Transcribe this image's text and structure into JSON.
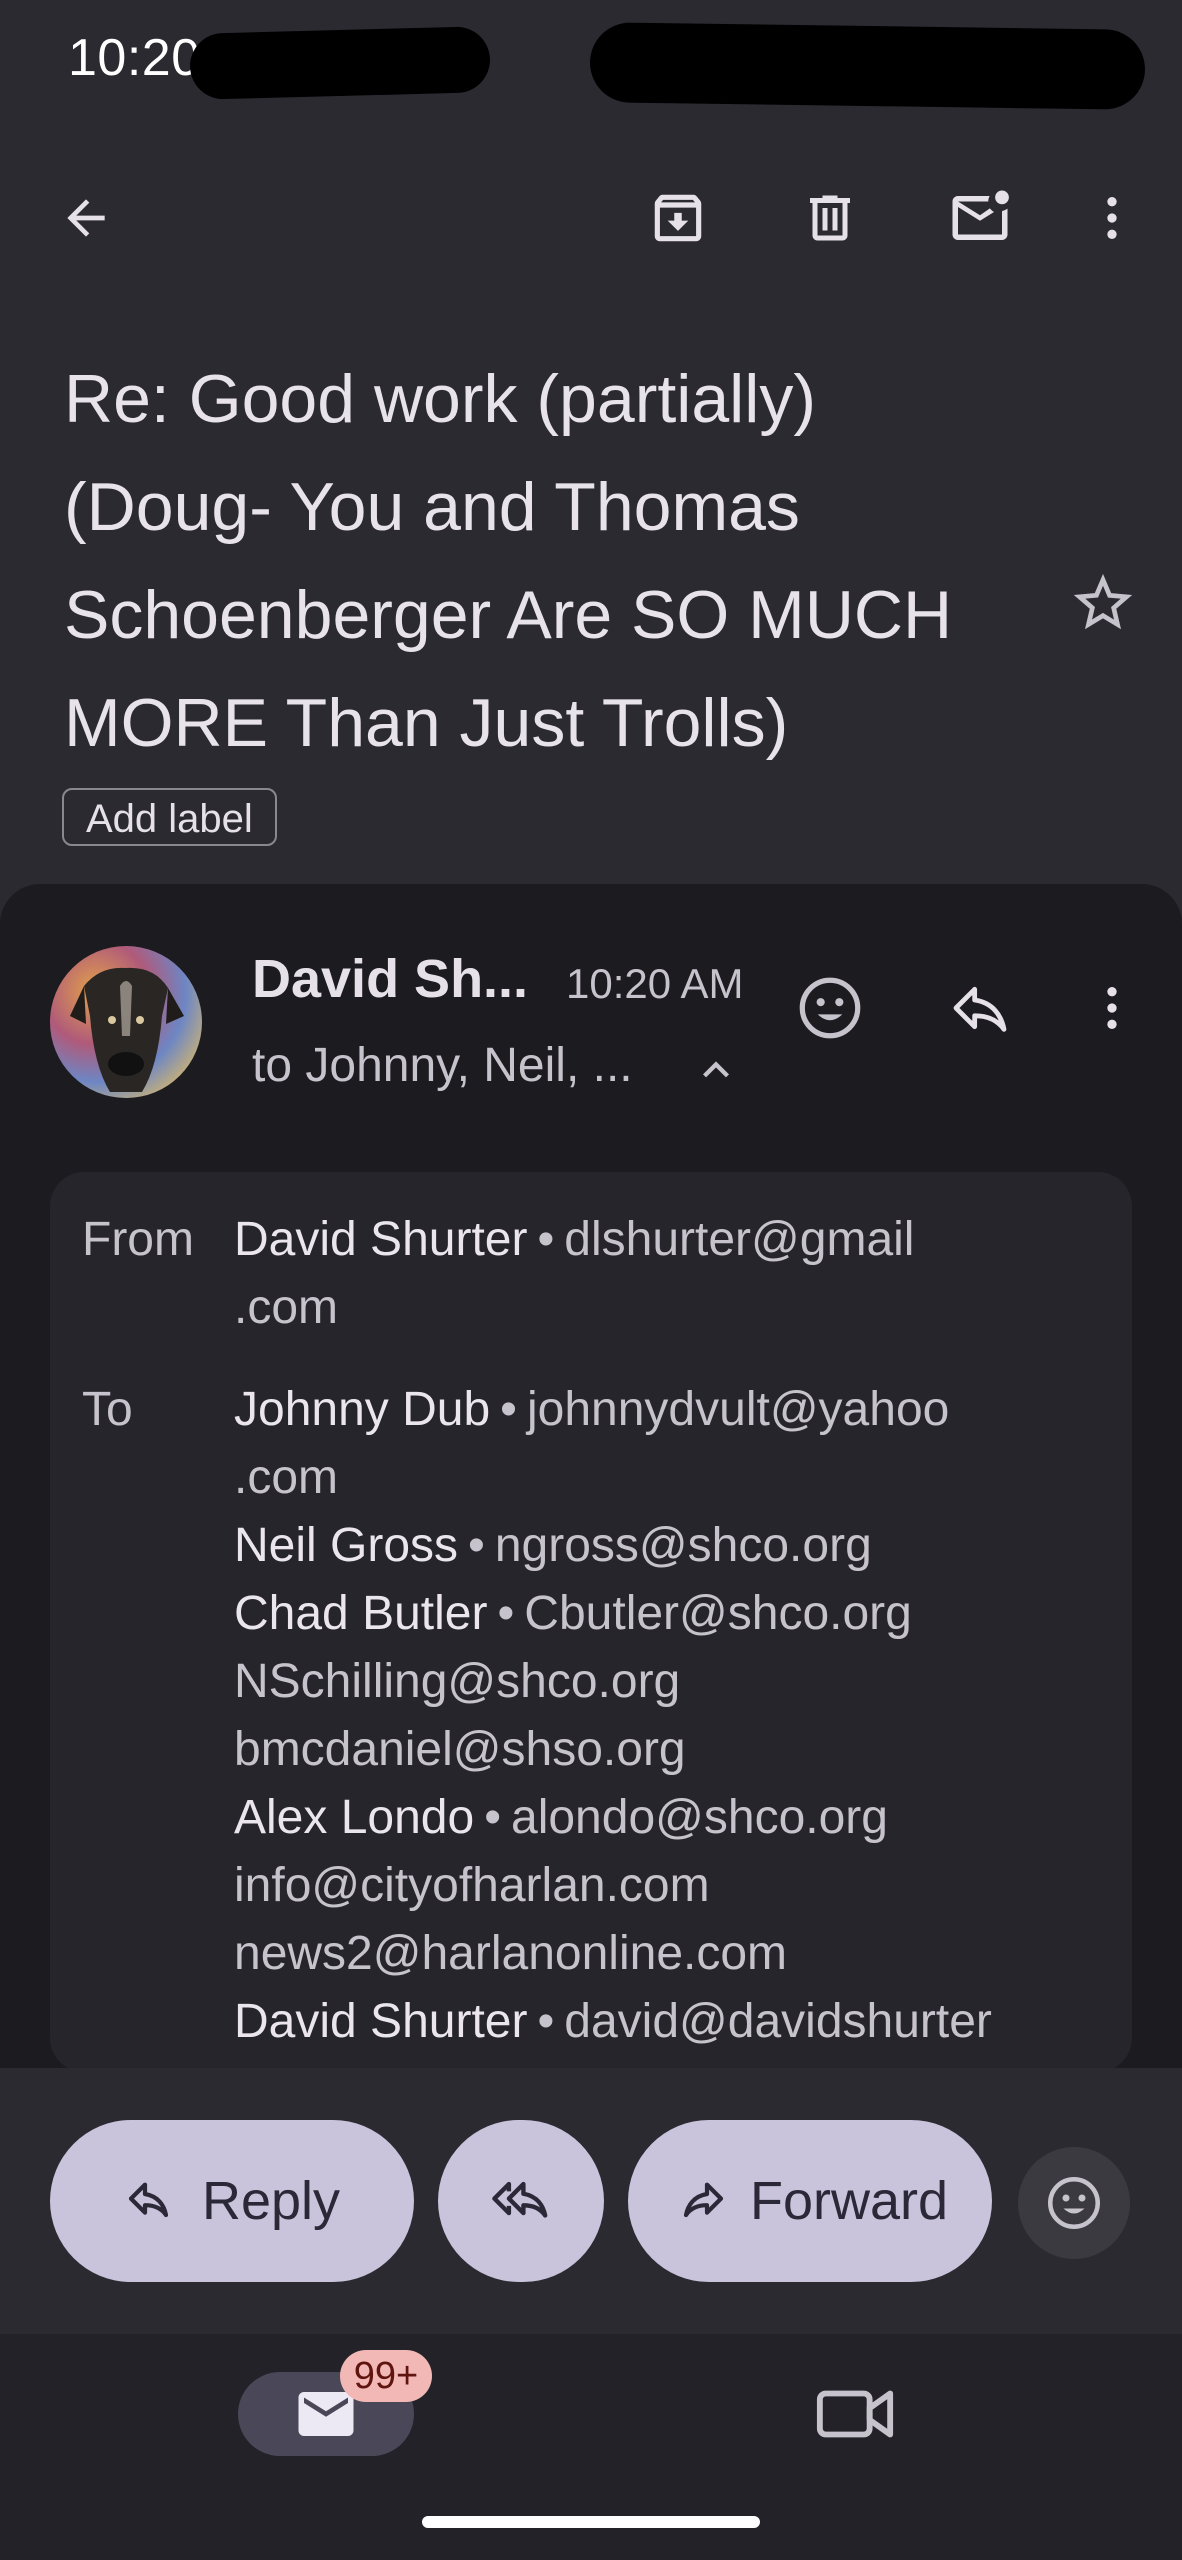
{
  "status_bar": {
    "time": "10:20"
  },
  "top_bar": {
    "back_icon": "arrow-back-icon",
    "archive_icon": "archive-icon",
    "delete_icon": "trash-icon",
    "unread_icon": "mark-unread-icon",
    "more_icon": "more-vert-icon"
  },
  "subject": {
    "line1": "Re: Good work (partially)",
    "line2": "(Doug- You and Thomas",
    "line3": "Schoenberger Are SO MUCH",
    "line4": "MORE Than Just Trolls)",
    "add_label": "Add label"
  },
  "message": {
    "sender": "David Sh...",
    "time": "10:20 AM",
    "recipients_summary": "to Johnny, Neil, ..."
  },
  "details": {
    "from_label": "From",
    "to_label": "To",
    "from": {
      "name": "David Shurter",
      "email_line1": "dlshurter@gmail",
      "email_line2": ".com"
    },
    "to": [
      {
        "name": "Johnny Dub",
        "email": "johnnydvult@yahoo"
      },
      {
        "name": "",
        "email": ".com"
      },
      {
        "name": "Neil Gross",
        "email": "ngross@shco.org"
      },
      {
        "name": "Chad Butler",
        "email": "Cbutler@shco.org"
      },
      {
        "name": "",
        "email": "NSchilling@shco.org"
      },
      {
        "name": "",
        "email": "bmcdaniel@shso.org"
      },
      {
        "name": "Alex Londo",
        "email": "alondo@shco.org"
      },
      {
        "name": "",
        "email": "info@cityofharlan.com"
      },
      {
        "name": "",
        "email": "news2@harlanonline.com"
      },
      {
        "name": "David Shurter",
        "email": "david@davidshurter"
      }
    ]
  },
  "actions": {
    "reply": "Reply",
    "forward": "Forward"
  },
  "nav": {
    "mail_badge": "99+"
  },
  "colors": {
    "background": "#2b2a31",
    "sheet": "#1c1b20",
    "pill": "#c9c4dc",
    "badge": "#f2b8b5"
  }
}
